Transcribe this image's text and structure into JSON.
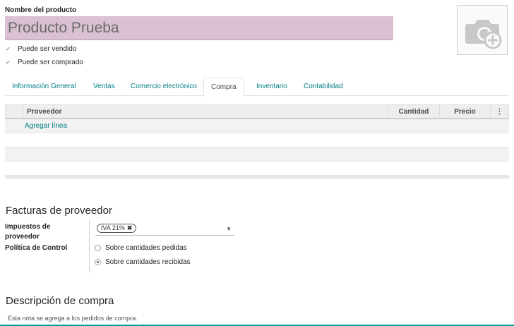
{
  "product": {
    "name_label": "Nombre del producto",
    "name_value": "Producto Prueba",
    "can_be_sold_label": "Puede ser vendido",
    "can_be_purchased_label": "Puede ser comprado"
  },
  "tabs": [
    {
      "label": "Información General"
    },
    {
      "label": "Ventas"
    },
    {
      "label": "Comercio electrónico"
    },
    {
      "label": "Compra",
      "active": true
    },
    {
      "label": "Inventario"
    },
    {
      "label": "Contabilidad"
    }
  ],
  "vendor_table": {
    "columns": [
      "Proveedor",
      "Cantidad",
      "Precio"
    ],
    "add_line_label": "Agregar línea"
  },
  "vendor_bills": {
    "title": "Facturas de proveedor",
    "taxes_label": "Impuestos de proveedor",
    "taxes_tag": "IVA 21%",
    "control_policy_label": "Política de Control",
    "options": [
      "Sobre cantidades pedidas",
      "Sobre cantidades recibidas"
    ],
    "selected_option_index": 1
  },
  "purchase_description": {
    "title": "Descripción de compra",
    "note": "Esta nota se agrega a los pedidos de compra."
  },
  "colors": {
    "accent": "#017e84",
    "required_field_bg": "#d9c0d2"
  }
}
